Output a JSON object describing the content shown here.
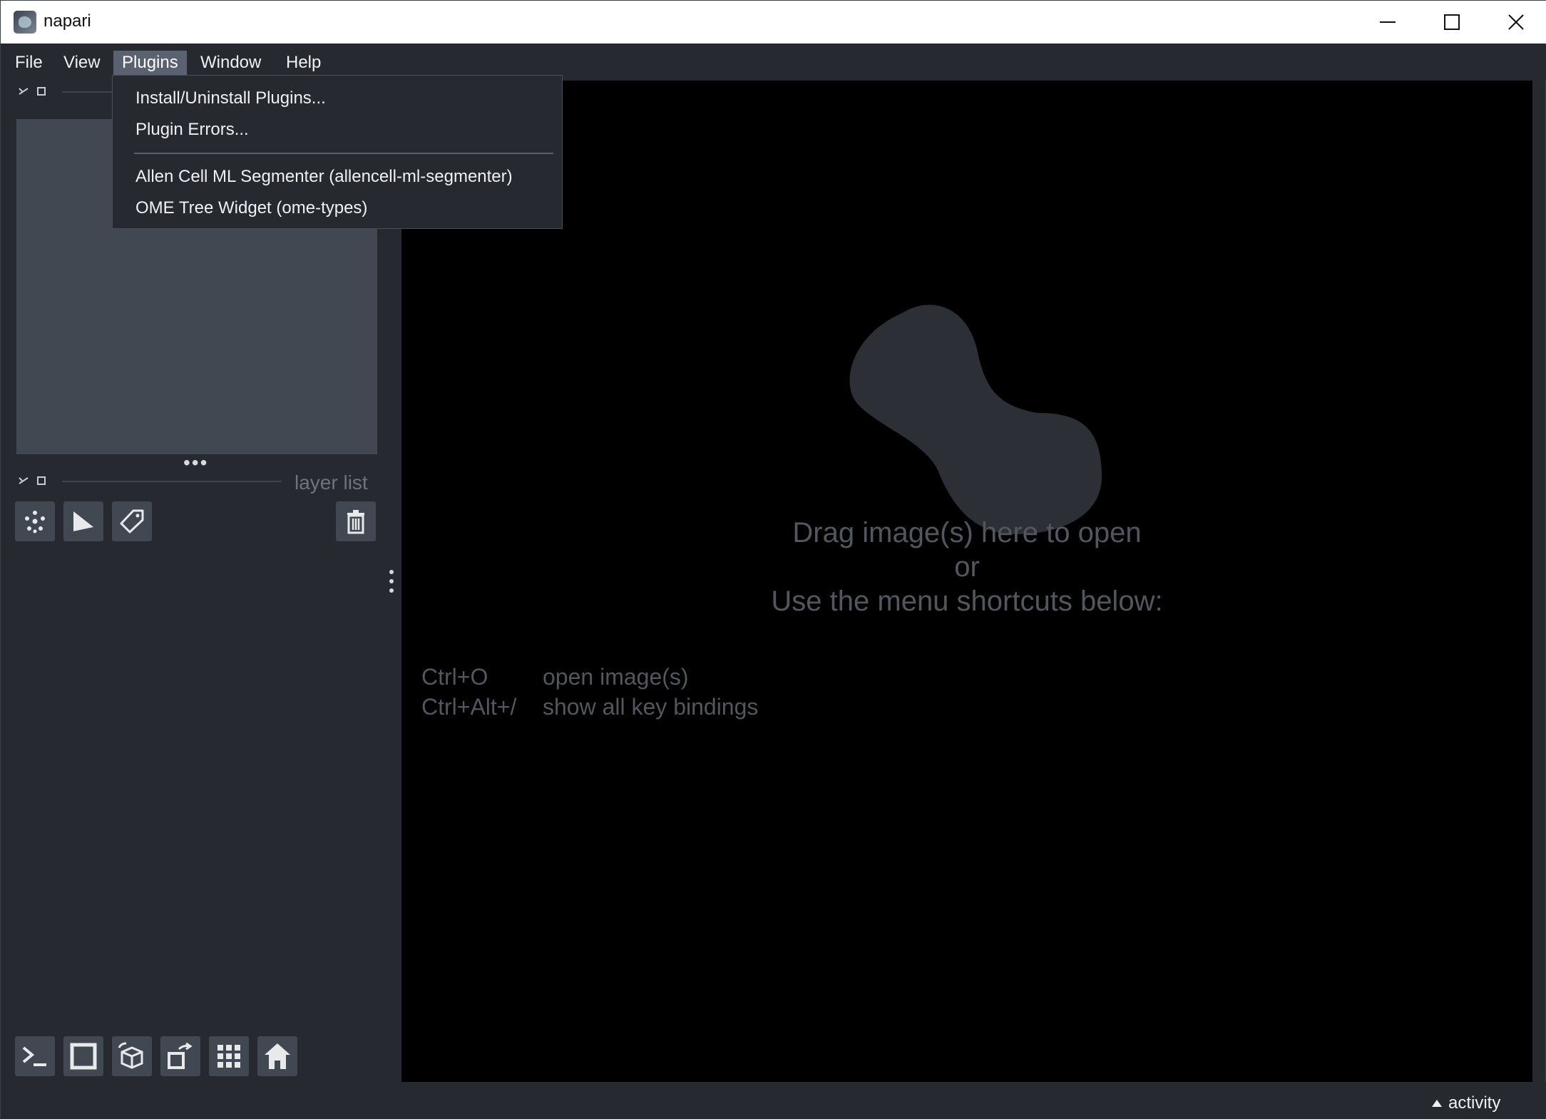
{
  "window": {
    "title": "napari"
  },
  "menubar": {
    "items": [
      {
        "label": "File"
      },
      {
        "label": "View"
      },
      {
        "label": "Plugins"
      },
      {
        "label": "Window"
      },
      {
        "label": "Help"
      }
    ],
    "active": "Plugins"
  },
  "plugins_menu": {
    "items": [
      {
        "label": "Install/Uninstall Plugins..."
      },
      {
        "label": "Plugin Errors..."
      },
      {
        "label": "Allen Cell ML Segmenter (allencell-ml-segmenter)"
      },
      {
        "label": "OME Tree Widget (ome-types)"
      }
    ]
  },
  "layer_list": {
    "title": "layer list"
  },
  "layer_buttons": [
    "new-points",
    "new-shapes",
    "new-labels",
    "delete-layer"
  ],
  "viewer_buttons": [
    "console",
    "ndisplay-2d",
    "roll-dims",
    "transpose",
    "grid",
    "home"
  ],
  "canvas": {
    "welcome_line1": "Drag image(s) here to open",
    "welcome_line2": "or",
    "welcome_line3": "Use the menu shortcuts below:",
    "shortcuts": [
      {
        "keys": "Ctrl+O",
        "desc": "open image(s)"
      },
      {
        "keys": "Ctrl+Alt+/",
        "desc": "show all key bindings"
      }
    ]
  },
  "statusbar": {
    "activity_label": "activity"
  },
  "colors": {
    "background": "#262930",
    "canvas": "#000000",
    "panel": "#414851",
    "text": "#f0f1f2",
    "muted_text": "#52565e"
  }
}
